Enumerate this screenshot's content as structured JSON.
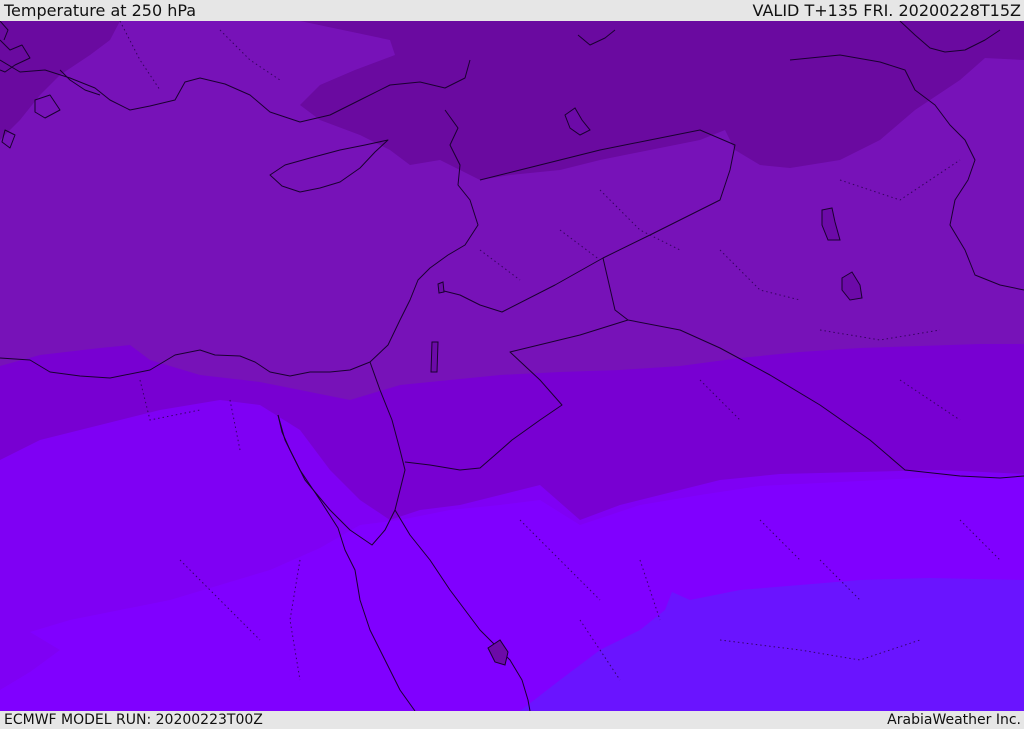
{
  "header": {
    "title": "Temperature at 250 hPa",
    "valid": "VALID T+135 FRI. 20200228T15Z"
  },
  "footer": {
    "model_run": "ECMWF MODEL RUN: 20200223T00Z",
    "credit": "ArabiaWeather Inc."
  },
  "colors": {
    "band_coldest": "#6a0aa0",
    "band_cold": "#7712b8",
    "band_mid": "#7800d2",
    "band_warm": "#7f00f4",
    "band_warmer": "#8000ff",
    "band_warmest": "#6a14ff",
    "borders": "#1a0030"
  }
}
